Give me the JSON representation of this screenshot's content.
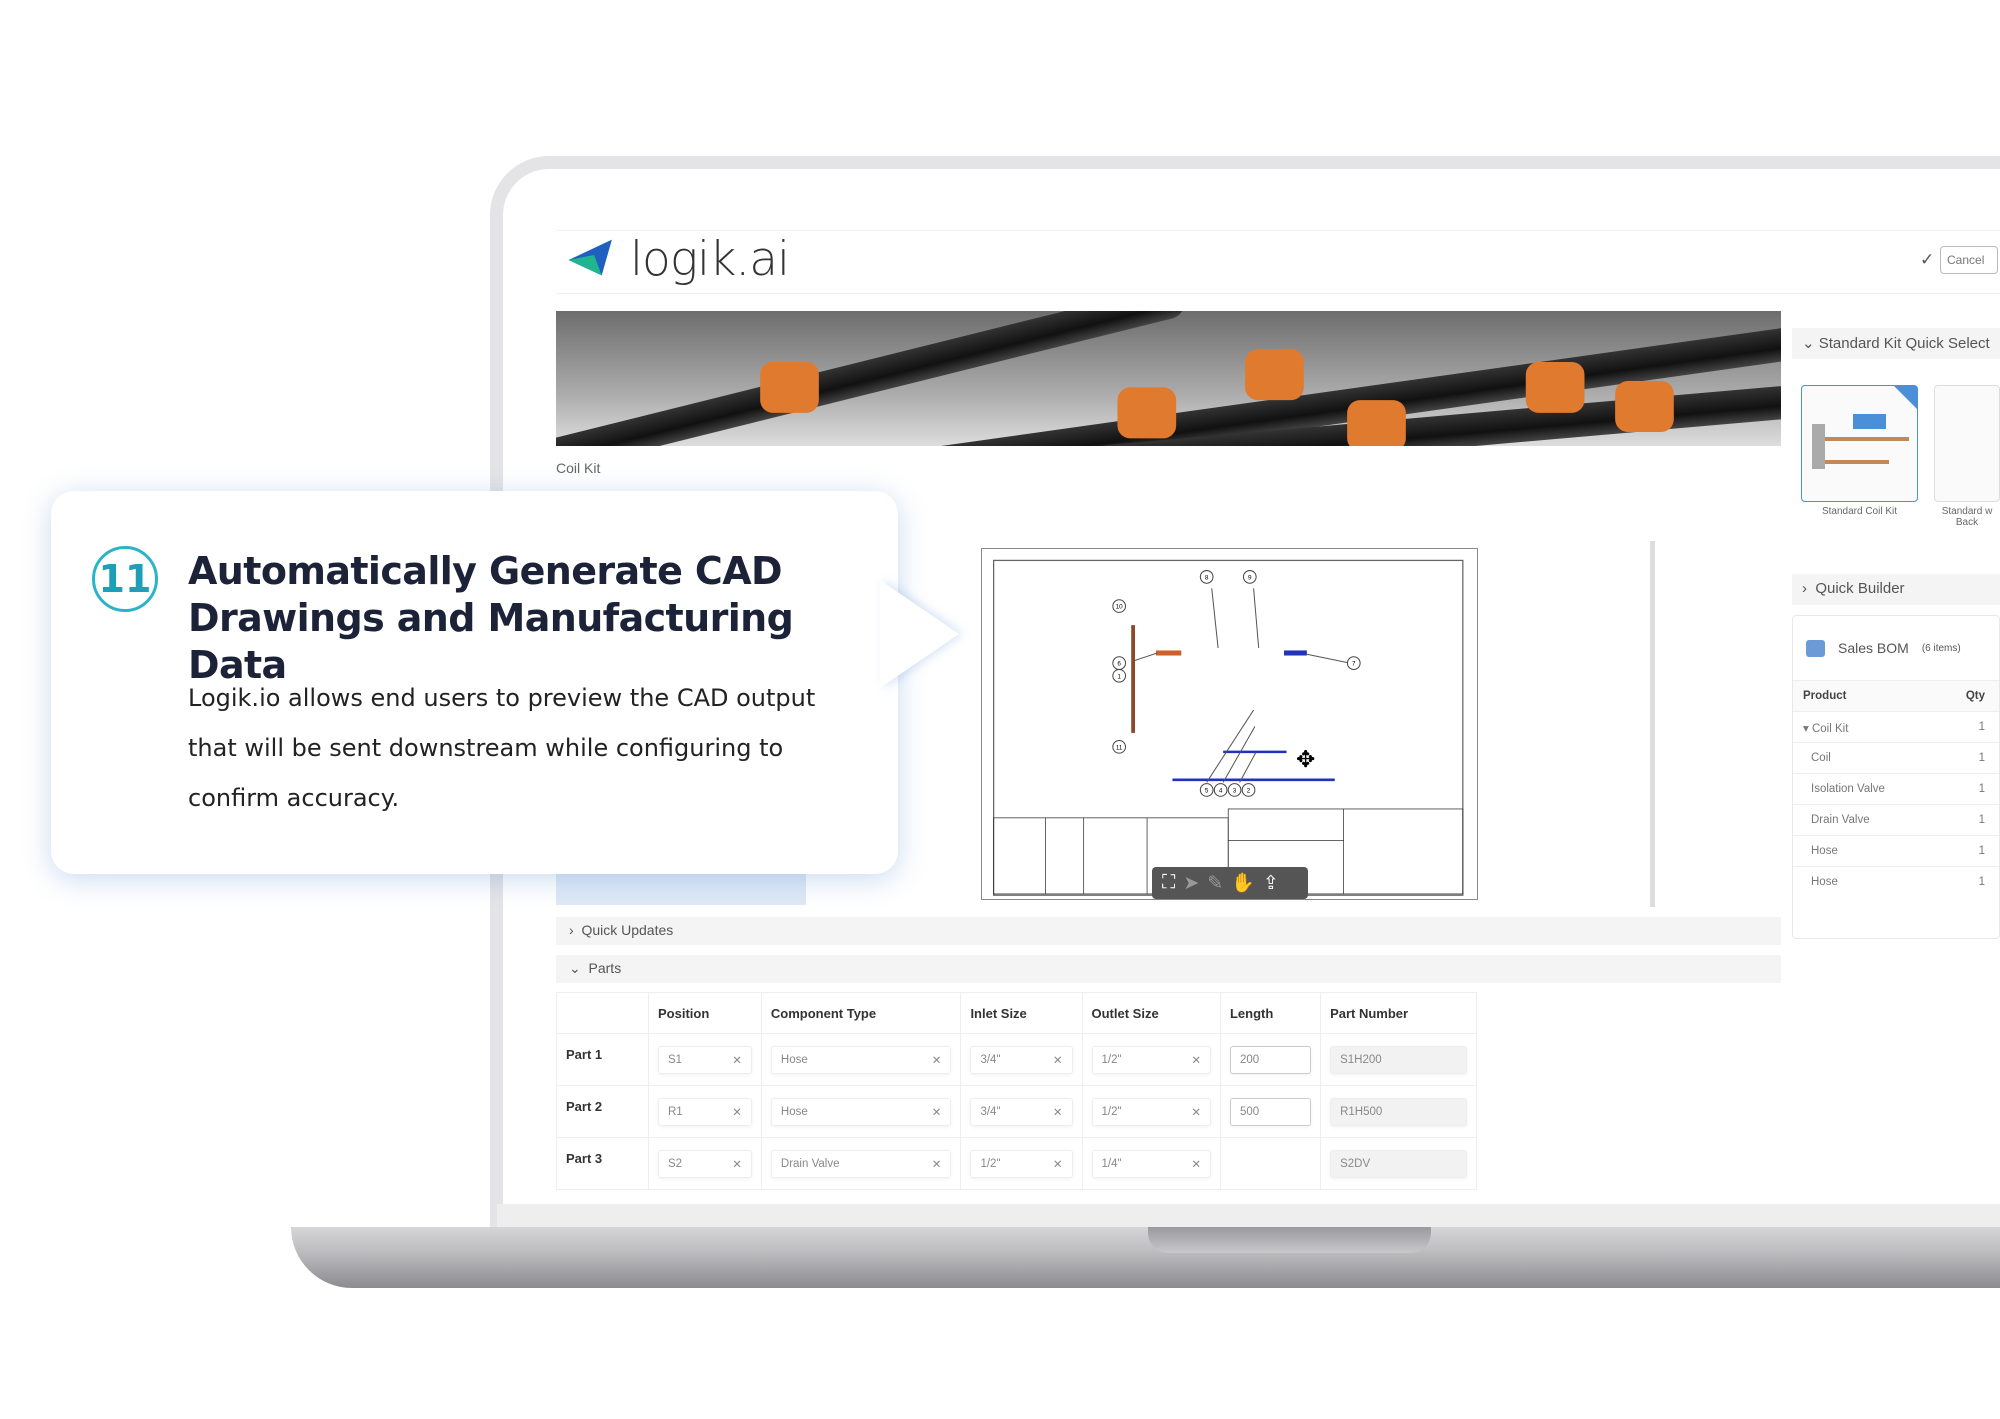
{
  "app": {
    "logo_text": "logik.ai",
    "cancel_label": "Cancel",
    "brand_colors": {
      "logo_teal": "#1fb58f",
      "logo_blue": "#1f5fbf",
      "accent": "#2bb3c9"
    }
  },
  "main": {
    "product_label": "Coil Kit"
  },
  "callout": {
    "number": "11",
    "title": "Automatically Generate CAD Drawings and Manufacturing Data",
    "body": "Logik.io allows end users to preview the CAD output that will be sent downstream while configuring to confirm accuracy."
  },
  "cad": {
    "balloons": [
      "10",
      "6",
      "1",
      "11",
      "8",
      "9",
      "7",
      "5",
      "4",
      "3",
      "2"
    ],
    "toolbar_icons": [
      "fit-view-icon",
      "select-icon",
      "measure-icon",
      "pan-hand-icon",
      "export-icon"
    ]
  },
  "sections": {
    "quick_updates": "Quick Updates",
    "parts": "Parts"
  },
  "parts": {
    "columns": [
      "Position",
      "Component Type",
      "Inlet Size",
      "Outlet Size",
      "Length",
      "Part Number"
    ],
    "rows": [
      {
        "label": "Part 1",
        "position": "S1",
        "component": "Hose",
        "inlet": "3/4\"",
        "outlet": "1/2\"",
        "length": "200",
        "part_number": "S1H200"
      },
      {
        "label": "Part 2",
        "position": "R1",
        "component": "Hose",
        "inlet": "3/4\"",
        "outlet": "1/2\"",
        "length": "500",
        "part_number": "R1H500"
      },
      {
        "label": "Part 3",
        "position": "S2",
        "component": "Drain Valve",
        "inlet": "1/2\"",
        "outlet": "1/4\"",
        "length": "",
        "part_number": "S2DV"
      }
    ]
  },
  "sidebar": {
    "kit_select_title": "Standard Kit Quick Select",
    "kits": [
      {
        "label": "Standard Coil Kit",
        "selected": true
      },
      {
        "label": "Standard w Back",
        "selected": false
      }
    ],
    "quick_builder": "Quick Builder",
    "bom": {
      "title": "Sales BOM",
      "count": "(6 items)",
      "col_product": "Product",
      "col_qty": "Qty",
      "rows": [
        {
          "product": "Coil Kit",
          "qty": "1"
        },
        {
          "product": "Coil",
          "qty": "1"
        },
        {
          "product": "Isolation Valve",
          "qty": "1"
        },
        {
          "product": "Drain Valve",
          "qty": "1"
        },
        {
          "product": "Hose",
          "qty": "1"
        },
        {
          "product": "Hose",
          "qty": "1"
        }
      ]
    }
  }
}
